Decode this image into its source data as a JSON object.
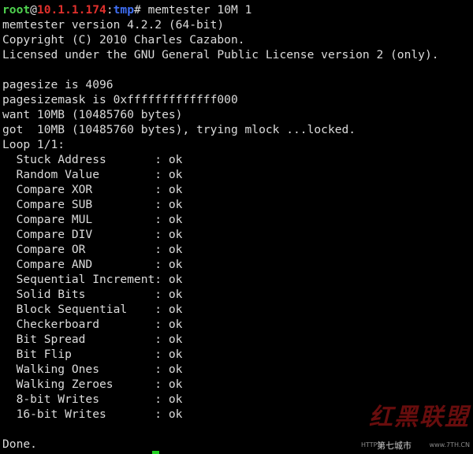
{
  "prompt": {
    "user": "root",
    "at": "@",
    "host": "10.1.1.174",
    "colon": ":",
    "dir": "tmp",
    "symbol": "#",
    "command": " memtester 10M 1"
  },
  "header_lines": [
    "memtester version 4.2.2 (64-bit)",
    "Copyright (C) 2010 Charles Cazabon.",
    "Licensed under the GNU General Public License version 2 (only).",
    "",
    "pagesize is 4096",
    "pagesizemask is 0xfffffffffffff000",
    "want 10MB (10485760 bytes)",
    "got  10MB (10485760 bytes), trying mlock ...locked.",
    "Loop 1/1:"
  ],
  "tests": [
    "  Stuck Address       : ok",
    "  Random Value        : ok",
    "  Compare XOR         : ok",
    "  Compare SUB         : ok",
    "  Compare MUL         : ok",
    "  Compare DIV         : ok",
    "  Compare OR          : ok",
    "  Compare AND         : ok",
    "  Sequential Increment: ok",
    "  Solid Bits          : ok",
    "  Block Sequential    : ok",
    "  Checkerboard        : ok",
    "  Bit Spread          : ok",
    "  Bit Flip            : ok",
    "  Walking Ones        : ok",
    "  Walking Zeroes      : ok",
    "  8-bit Writes        : ok",
    "  16-bit Writes       : ok"
  ],
  "footer_lines": [
    "",
    "Done."
  ],
  "watermark": {
    "main": "红黑联盟",
    "sub": "第七城市",
    "http": "HTTP",
    "url": "www.7TH.CN"
  },
  "colors": {
    "background": "#000000",
    "text": "#dcdcdc",
    "prompt_user": "#4fd34f",
    "prompt_host": "#e0302c",
    "prompt_dir": "#3f6ff5",
    "cursor": "#22d022"
  }
}
